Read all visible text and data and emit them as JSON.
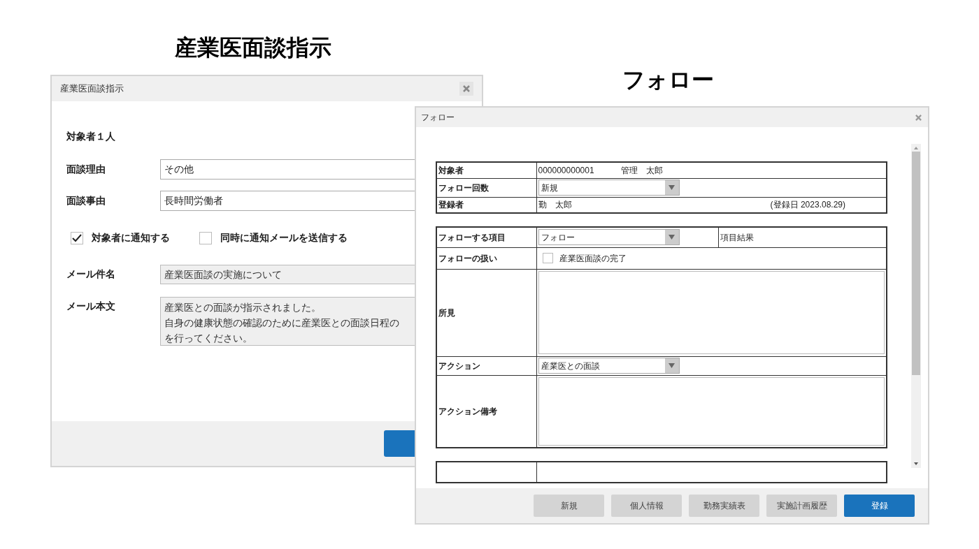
{
  "headings": [
    {
      "text": "産業医面談指示"
    },
    {
      "text": "フォロー"
    }
  ],
  "interview_dialog": {
    "title": "産業医面談指示",
    "target_count": "対象者１人",
    "fields": [
      {
        "label": "面談理由",
        "value": "その他"
      },
      {
        "label": "面談事由",
        "value": "長時間労働者"
      }
    ],
    "checkboxes": [
      {
        "label": "対象者に通知する",
        "checked": true
      },
      {
        "label": "同時に通知メールを送信する",
        "checked": false
      }
    ],
    "mail_fields": [
      {
        "label": "メール件名",
        "kind": "input",
        "value": "産業医面談の実施について"
      },
      {
        "label": "メール本文",
        "kind": "textarea",
        "lines": [
          "産業医との面談が指示されました。",
          "自身の健康状態の確認のために産業医との面談日程の",
          "を行ってください。"
        ]
      }
    ]
  },
  "follow_dialog": {
    "title": "フォロー",
    "info_rows": [
      {
        "label": "対象者",
        "kind": "text",
        "value": "000000000001",
        "value_2": "管理　太郎"
      },
      {
        "label": "フォロー回数",
        "kind": "select",
        "value": "新規"
      },
      {
        "label": "登録者",
        "kind": "text",
        "value": "勤　太郎",
        "note": "(登録日 2023.08.29)"
      }
    ],
    "detail_rows": [
      {
        "label": "フォローする項目",
        "kind": "select",
        "value": "フォロー",
        "extra": "項目結果"
      },
      {
        "label": "フォローの扱い",
        "kind": "checkbox",
        "value": "産業医面談の完了",
        "checked": false
      },
      {
        "label": "所見",
        "kind": "textarea"
      },
      {
        "label": "アクション",
        "kind": "select",
        "value": "産業医との面談"
      },
      {
        "label": "アクション備考",
        "kind": "textarea"
      }
    ],
    "buttons": [
      {
        "label": "新規",
        "primary": false
      },
      {
        "label": "個人情報",
        "primary": false
      },
      {
        "label": "勤務実績表",
        "primary": false
      },
      {
        "label": "実施計画履歴",
        "primary": false
      },
      {
        "label": "登録",
        "primary": true
      }
    ]
  }
}
